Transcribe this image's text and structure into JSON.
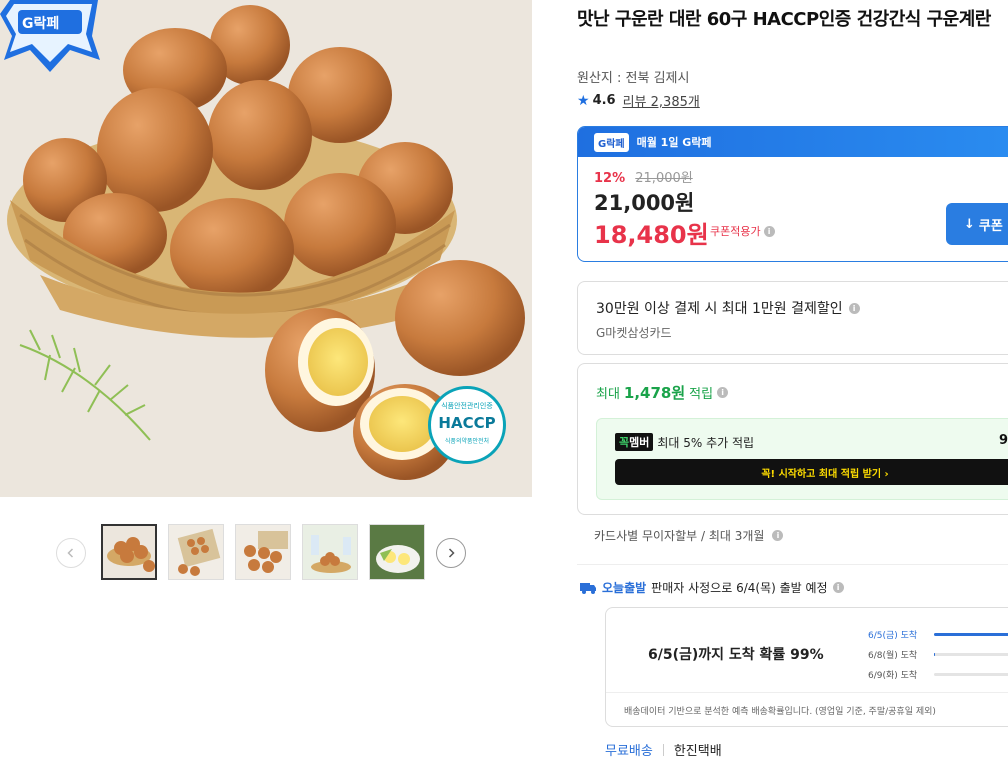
{
  "product": {
    "title": "맛난 구운란 대란 60구 HACCP인증 건강간식 구운계란",
    "origin": "원산지 : 전북 김제시",
    "rating": "4.6",
    "review_label": "리뷰 2,385개",
    "logo_text": "G락페",
    "haccp_badge": "HACCP",
    "haccp_top": "식품안전관리인증",
    "haccp_bottom": "식품의약품안전처"
  },
  "price": {
    "promo_badge": "G락페",
    "promo_label": "매월 1일 G락페",
    "discount_rate": "12%",
    "original": "21,000원",
    "price": "21,000원",
    "coupon_price": "18,480원",
    "coupon_note": "쿠폰적용가",
    "coupon_button": "쿠폰"
  },
  "card_benefit": {
    "title": "30만원 이상 결제 시 최대 1만원 결제할인",
    "card": "G마켓삼성카드"
  },
  "points": {
    "prefix": "최대",
    "amount": "1,478원",
    "suffix": "적립",
    "member_badge_a": "꼭",
    "member_badge_b": "멤버",
    "member_text": "최대 5% 추가 적립",
    "member_right": "9",
    "member_button": "꼭! 시작하고 최대 적립 받기 ›"
  },
  "installment": "카드사별 무이자할부 / 최대 3개월",
  "shipping": {
    "today_label": "오늘출발",
    "desc": "판매자 사정으로 6/4(목) 출발 예정",
    "main": "6/5(금)까지 도착 확률 99%",
    "probabilities": [
      {
        "label": "6/5(금) 도착",
        "value": 0.99
      },
      {
        "label": "6/8(월) 도착",
        "value": 0.01
      },
      {
        "label": "6/9(화) 도착",
        "value": 0.0
      }
    ],
    "note": "배송데이터 기반으로 분석한 예측 배송확률입니다. (영업일 기준, 주말/공휴일 제외)",
    "free": "무료배송",
    "courier": "한진택배"
  },
  "colors": {
    "accent": "#2a7de1",
    "sale": "#e8334a",
    "point": "#1aa34a"
  }
}
